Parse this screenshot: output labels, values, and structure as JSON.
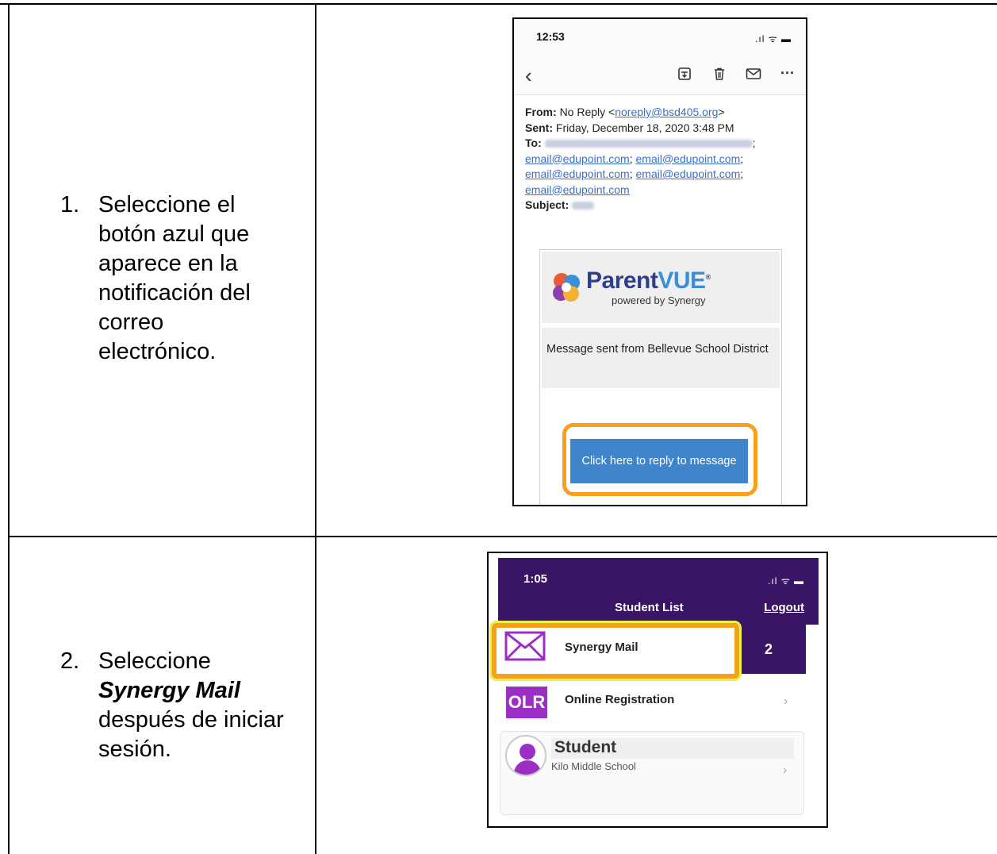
{
  "steps": [
    {
      "number": "1.",
      "lines": [
        "Seleccione el",
        "botón azul que",
        "aparece en la",
        "notificación del",
        "correo",
        "electrónico."
      ]
    },
    {
      "number": "2.",
      "line1": "Seleccione",
      "emphasis": "Synergy Mail",
      "line3": "después de iniciar",
      "line4": "sesión."
    }
  ],
  "email_screen": {
    "time": "12:53",
    "signal": ".ıl ᯤ ▬",
    "from_label": "From:",
    "from_name": "No Reply <",
    "from_email": "noreply@bsd405.org",
    "from_close": ">",
    "sent_label": "Sent:",
    "sent_value": "Friday, December 18, 2020 3:48 PM",
    "to_label": "To:",
    "recipients": [
      "email@edupoint.com",
      "email@edupoint.com",
      "email@edupoint.com",
      "email@edupoint.com",
      "email@edupoint.com"
    ],
    "subject_label": "Subject:",
    "brand_name_1": "Parent",
    "brand_name_2": "VUE",
    "brand_tagline": "powered by Synergy",
    "message": "Message sent from Bellevue School District",
    "reply_button": "Click here to reply to message"
  },
  "student_screen": {
    "time": "1:05",
    "signal": ".ıl ᯤ ▬",
    "title": "Student List",
    "logout": "Logout",
    "mail_label": "Synergy Mail",
    "mail_count": "2",
    "olr_icon": "OLR",
    "olr_label": "Online Registration",
    "student_name": "Student",
    "school": "Kilo Middle School"
  },
  "colors": {
    "highlight": "#f5a11c",
    "reply_button": "#3e85cb",
    "header_purple": "#3a1565",
    "olr_purple": "#9b2fc4"
  }
}
